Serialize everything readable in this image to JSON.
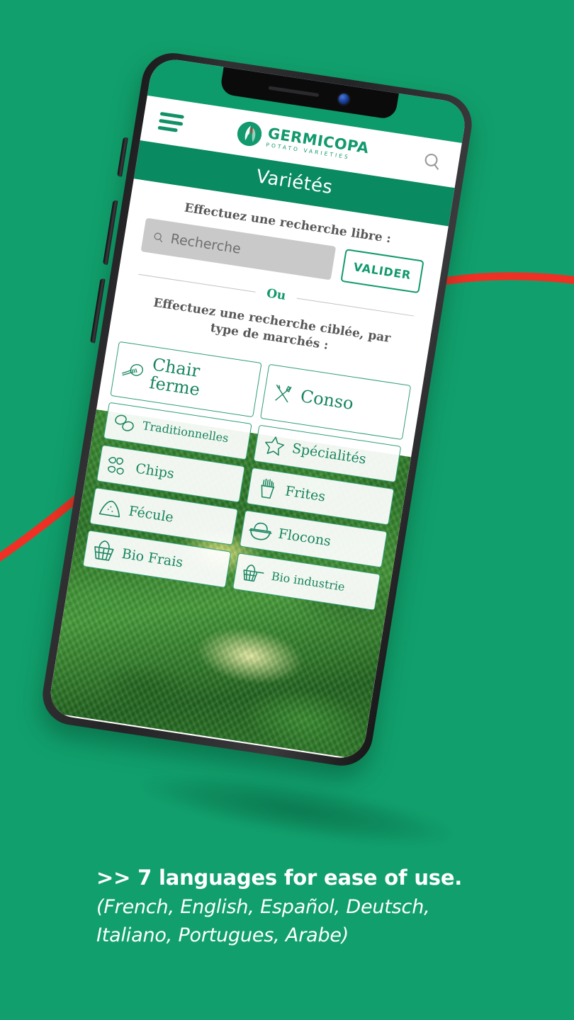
{
  "background": {
    "page_green": "#11a06d",
    "accent_red": "#ee3124",
    "brand_green": "#12996d",
    "header_green": "#098a61"
  },
  "device": {
    "notch": {
      "speaker": "speaker-slot",
      "camera": "front-camera"
    },
    "side_buttons": [
      "volume-up",
      "volume-down",
      "power"
    ]
  },
  "app": {
    "topbar": {
      "menu_icon": "hamburger-menu-icon",
      "search_icon": "search-icon",
      "logo": {
        "mark": "germicopa-flower-logo",
        "name": "GERMICOPA",
        "tagline": "POTATO VARIETIES"
      }
    },
    "page_title": "Variétés",
    "free_search": {
      "label": "Effectuez une recherche libre :",
      "input_icon": "search-icon",
      "input_value": "",
      "input_placeholder": "Recherche",
      "submit_label": "VALIDER"
    },
    "divider": {
      "word": "Ou"
    },
    "targeted_search": {
      "label": "Effectuez une recherche ciblée, par type de marchés :",
      "categories": [
        {
          "label": "Chair ferme",
          "icon": "potato-fork-icon",
          "size": "big"
        },
        {
          "label": "Conso",
          "icon": "fork-knife-icon",
          "size": "big"
        },
        {
          "label": "Traditionnelles",
          "icon": "two-potatoes-icon",
          "size": "small"
        },
        {
          "label": "Spécialités",
          "icon": "star-icon",
          "size": "normal"
        },
        {
          "label": "Chips",
          "icon": "chips-icon",
          "size": "normal"
        },
        {
          "label": "Frites",
          "icon": "fries-cup-icon",
          "size": "normal"
        },
        {
          "label": "Fécule",
          "icon": "starch-pile-icon",
          "size": "normal"
        },
        {
          "label": "Flocons",
          "icon": "flakes-bowl-icon",
          "size": "normal"
        },
        {
          "label": "Bio Frais",
          "icon": "basket-icon",
          "size": "normal"
        },
        {
          "label": "Bio industrie",
          "icon": "basket-factory-icon",
          "size": "small"
        }
      ]
    }
  },
  "caption": {
    "headline": ">> 7 languages for ease of use.",
    "subline_1": "(French, English, Español, Deutsch,",
    "subline_2": "Italiano, Portugues, Arabe)"
  }
}
